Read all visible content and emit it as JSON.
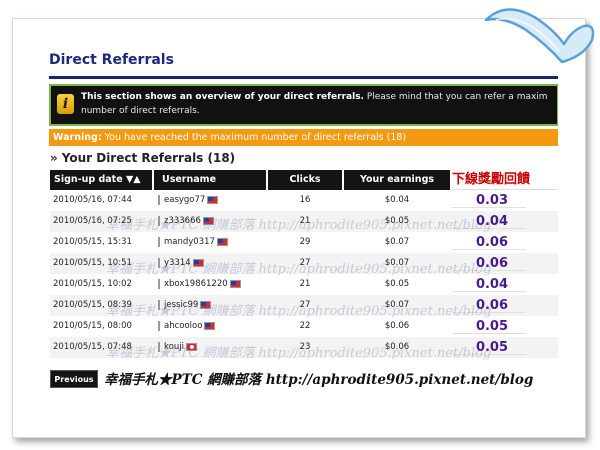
{
  "page": {
    "title": "Direct Referrals",
    "info_bold": "This section shows an overview of your direct referrals.",
    "info_rest": " Please mind that you can refer a maxim",
    "info_line2": "number of direct referrals.",
    "warning_label": "Warning:",
    "warning_text": " You have reached the maximum number of direct referrals (18)",
    "section_arrows": "»",
    "section_title": "Your Direct Referrals (18)"
  },
  "table": {
    "headers": {
      "date": "Sign-up date ▼▲",
      "username": "Username",
      "clicks": "Clicks",
      "earnings": "Your earnings",
      "extra": "下線獎勵回饋"
    },
    "rows": [
      {
        "date": "2010/05/16, 07:44",
        "username": "easygo77",
        "flag": "tw",
        "clicks": "16",
        "earnings": "$0.04",
        "extra": "0.03"
      },
      {
        "date": "2010/05/16, 07:25",
        "username": "z333666",
        "flag": "tw",
        "clicks": "21",
        "earnings": "$0.05",
        "extra": "0.04"
      },
      {
        "date": "2010/05/15, 15:31",
        "username": "mandy0317",
        "flag": "tw",
        "clicks": "29",
        "earnings": "$0.07",
        "extra": "0.06"
      },
      {
        "date": "2010/05/15, 10:51",
        "username": "y3314",
        "flag": "tw",
        "clicks": "27",
        "earnings": "$0.07",
        "extra": "0.06"
      },
      {
        "date": "2010/05/15, 10:02",
        "username": "xbox19861220",
        "flag": "tw",
        "clicks": "21",
        "earnings": "$0.05",
        "extra": "0.04"
      },
      {
        "date": "2010/05/15, 08:39",
        "username": "jessic99",
        "flag": "tw",
        "clicks": "27",
        "earnings": "$0.07",
        "extra": "0.06"
      },
      {
        "date": "2010/05/15, 08:00",
        "username": "ahcooloo",
        "flag": "tw",
        "clicks": "22",
        "earnings": "$0.06",
        "extra": "0.05"
      },
      {
        "date": "2010/05/15, 07:48",
        "username": "kouji",
        "flag": "hk",
        "clicks": "23",
        "earnings": "$0.06",
        "extra": "0.05"
      }
    ]
  },
  "watermark": "幸福手札★PTC 網賺部落 http://aphrodite905.pixnet.net/blog",
  "pager": {
    "previous_label": "Previous",
    "footer_text": "幸福手札★PTC 網賺部落 http://aphrodite905.pixnet.net/blog"
  },
  "icons": {
    "info": "info-icon",
    "decoration": "heart-ribbon-icon"
  },
  "colors": {
    "title": "#1a2a80",
    "warning_bg": "#f59a10",
    "info_border": "#7ab640",
    "extra_value": "#4a1a8a",
    "extra_header": "#cc0000"
  }
}
